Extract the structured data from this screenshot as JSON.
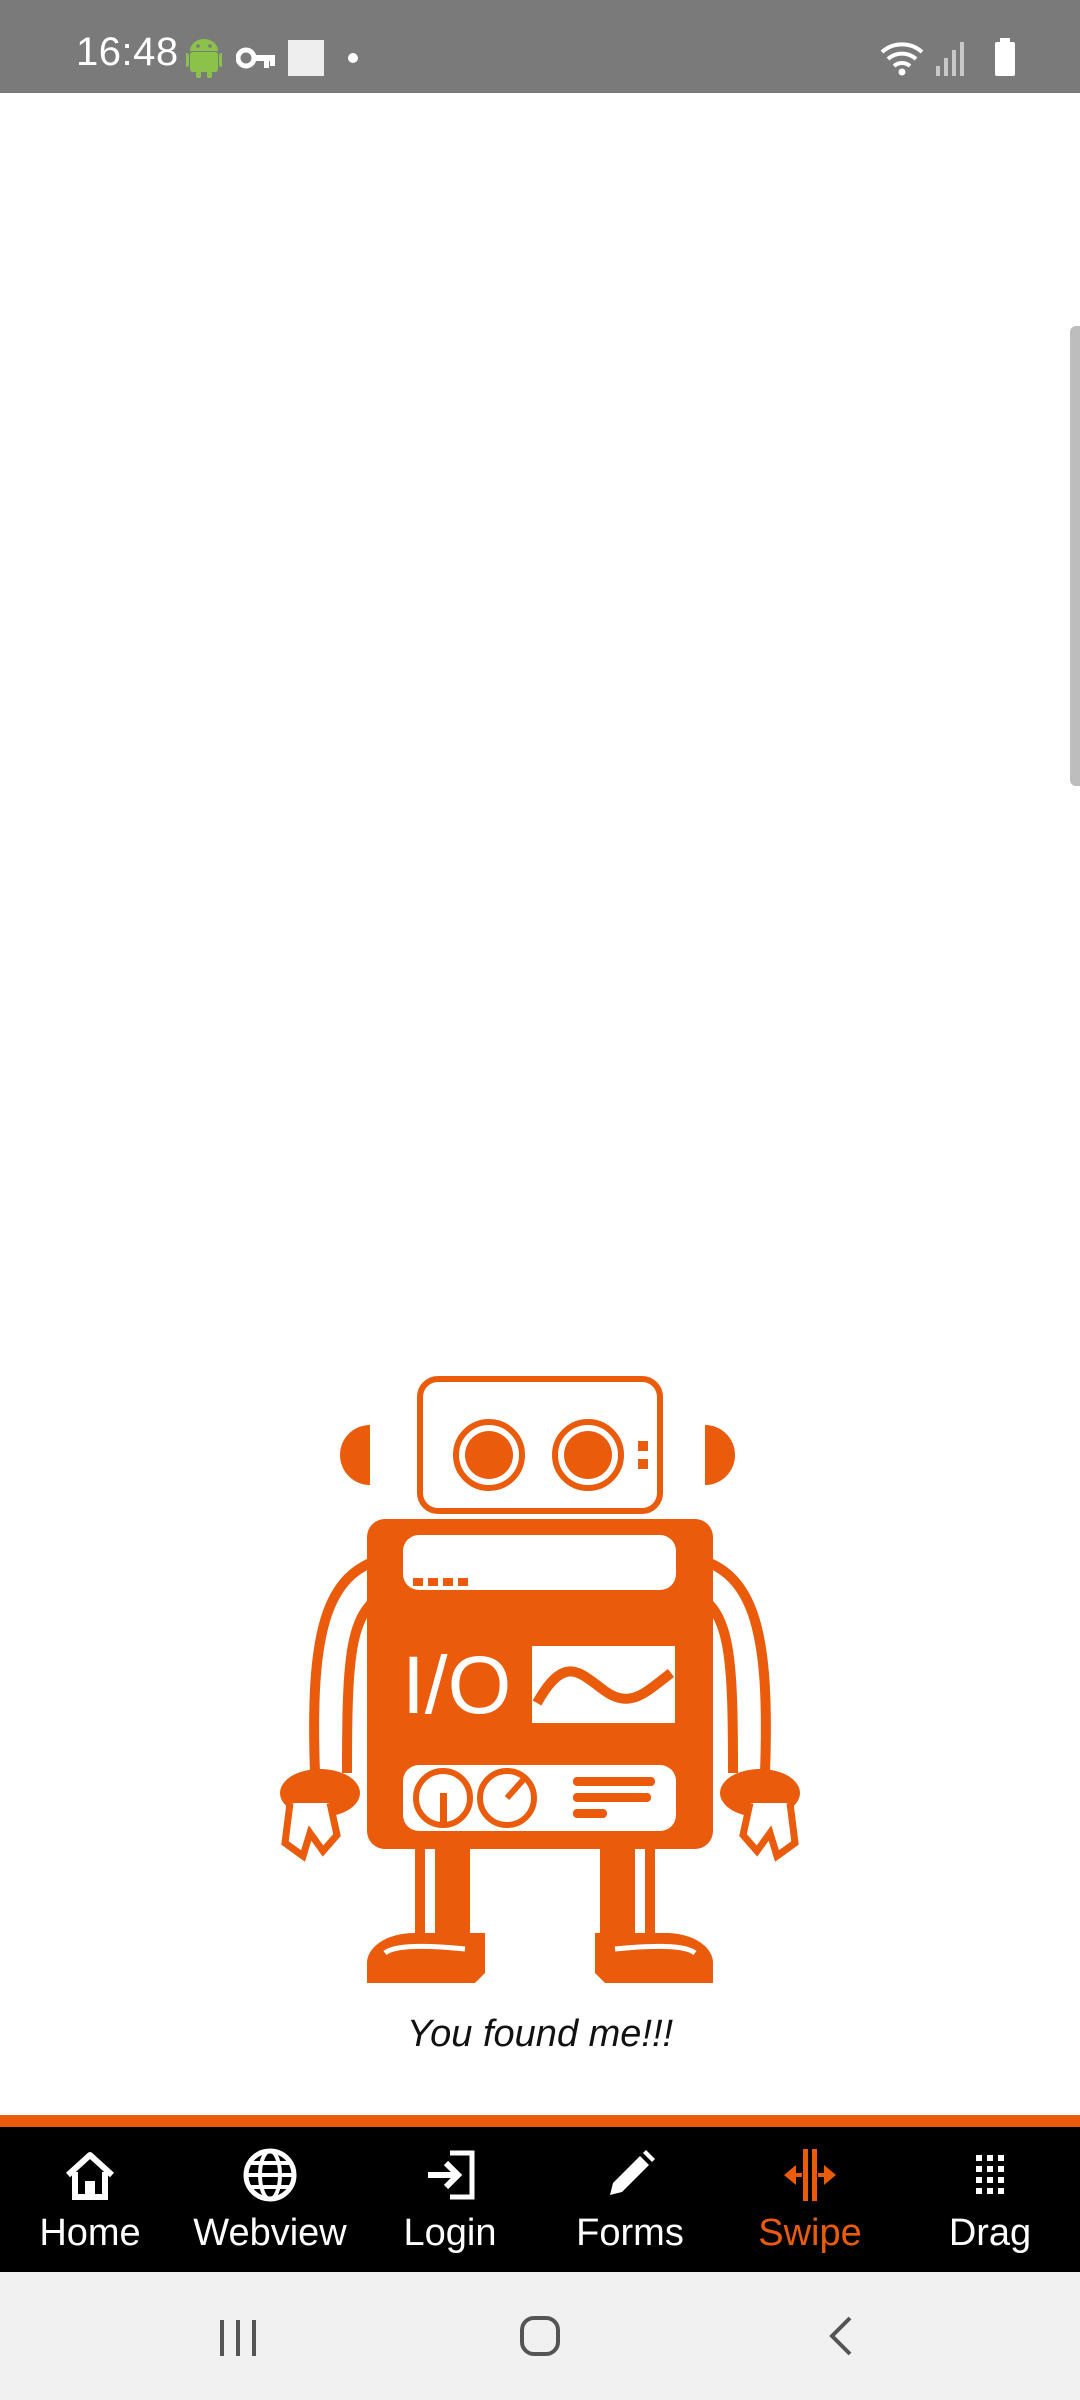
{
  "status_bar": {
    "time": "16:48",
    "left_icons": [
      "android-icon",
      "key-icon",
      "square-notification-icon",
      "dot-icon"
    ],
    "right_icons": [
      "wifi-icon",
      "cellular-signal-icon",
      "battery-icon"
    ]
  },
  "main": {
    "found_text": "You found me!!!",
    "robot_panel_text": "I/O"
  },
  "tab_bar": {
    "tabs": [
      {
        "label": "Home",
        "icon": "home-icon"
      },
      {
        "label": "Webview",
        "icon": "globe-icon"
      },
      {
        "label": "Login",
        "icon": "login-icon"
      },
      {
        "label": "Forms",
        "icon": "pencil-icon"
      },
      {
        "label": "Swipe",
        "icon": "swipe-icon"
      },
      {
        "label": "Drag",
        "icon": "grid-dots-icon"
      }
    ],
    "active_tab": "Swipe"
  },
  "nav_bar": {
    "buttons": [
      "recent-apps-icon",
      "home-circle-icon",
      "back-icon"
    ]
  },
  "colors": {
    "accent": "#ea5b0c",
    "status_bar_bg": "#7a7a7a",
    "tab_bar_bg": "#000000",
    "nav_bar_bg": "#f1f1f1"
  }
}
